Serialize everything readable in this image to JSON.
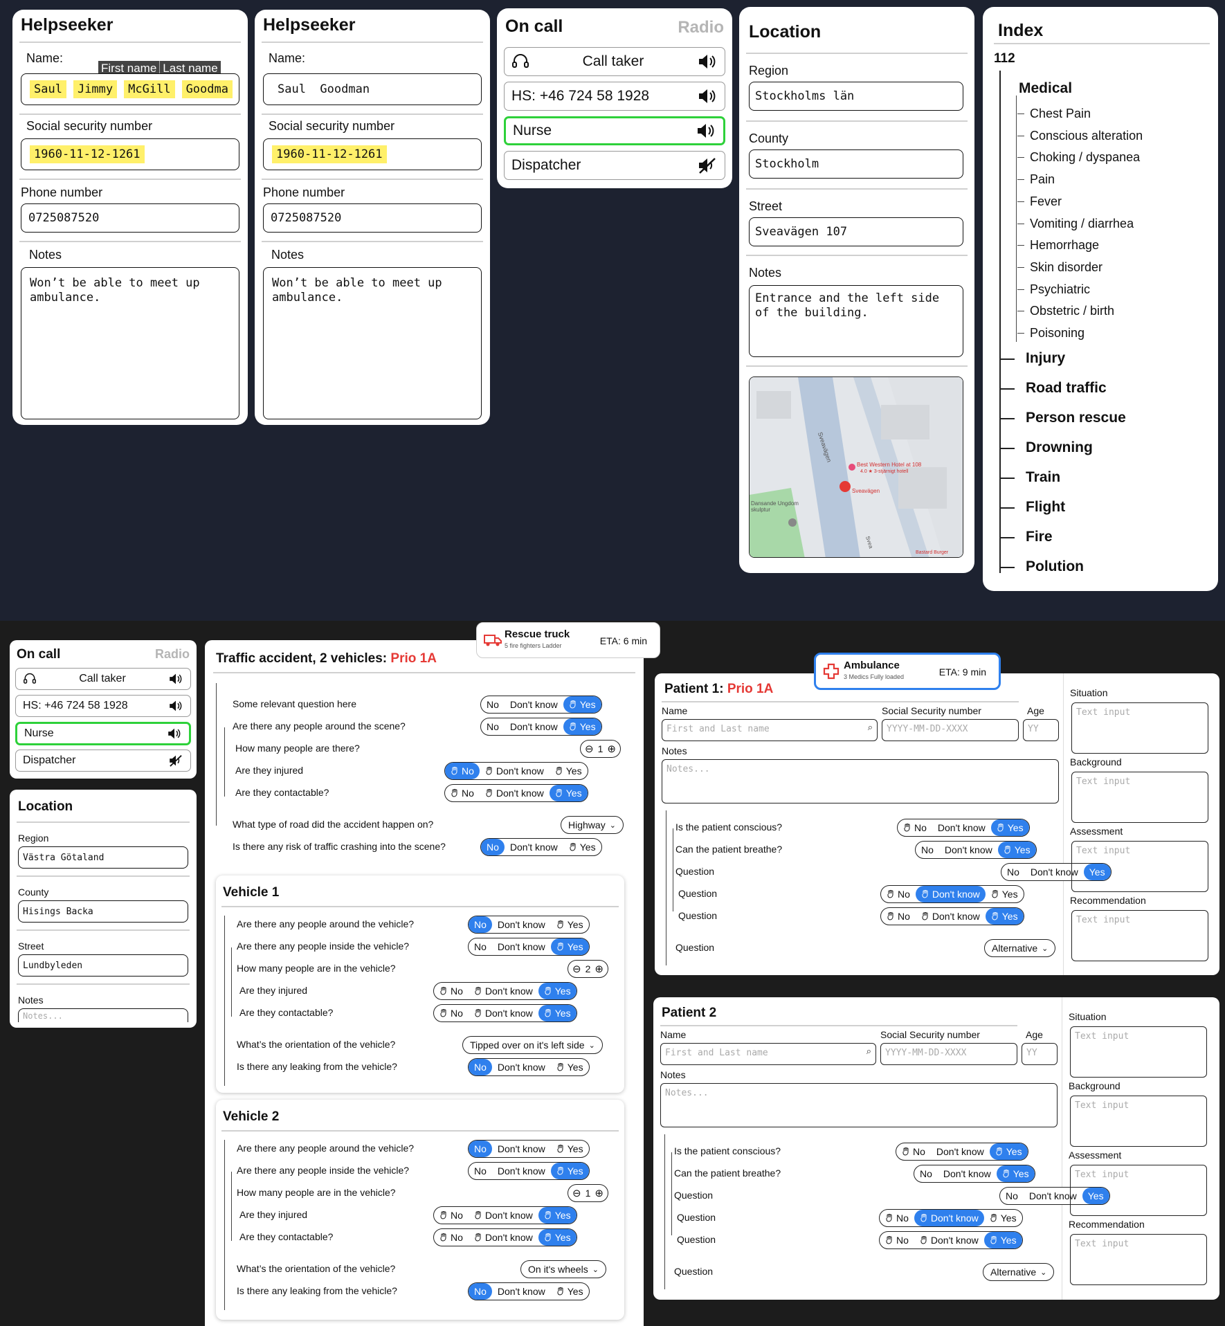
{
  "helpseeker1": {
    "title": "Helpseeker",
    "name_label": "Name:",
    "tooltip_first": "First name",
    "tooltip_last": "Last name",
    "name_parts": [
      "Saul",
      "Jimmy",
      "McGill",
      "Goodma"
    ],
    "ssn_label": "Social security number",
    "ssn": "1960-11-12-1261",
    "phone_label": "Phone number",
    "phone": "0725087520",
    "notes_label": "Notes",
    "notes": "Won’t be able to meet up ambulance."
  },
  "helpseeker2": {
    "title": "Helpseeker",
    "name_label": "Name:",
    "name": "Saul  Goodman",
    "ssn_label": "Social security number",
    "ssn": "1960-11-12-1261",
    "phone_label": "Phone number",
    "phone": "0725087520",
    "notes_label": "Notes",
    "notes": "Won’t be able to meet up ambulance."
  },
  "oncall": {
    "title": "On call",
    "radio": "Radio",
    "rows": [
      "Call taker",
      "HS: +46 724 58 1928",
      "Nurse",
      "Dispatcher"
    ]
  },
  "location1": {
    "title": "Location",
    "region_label": "Region",
    "region": "Stockholms län",
    "county_label": "County",
    "county": "Stockholm",
    "street_label": "Street",
    "street": "Sveavägen 107",
    "notes_label": "Notes",
    "notes": "Entrance and the left side of the building.",
    "map": {
      "street1": "Sveavägen",
      "street2": "Sveavägen",
      "hotel": "Best Western Hotel at 108",
      "hotel_sub": "4.0 ★ 3-stjärnigt hotell",
      "pin": "Sveavägen",
      "park": "Dansande Ungdom skulptur",
      "corner": "Bastard Burger",
      "street3": "Svea"
    }
  },
  "index": {
    "title": "Index",
    "root": "112",
    "medical": "Medical",
    "medical_items": [
      "Chest Pain",
      "Conscious alteration",
      "Choking / dyspanea",
      "Pain",
      "Fever",
      "Vomiting / diarrhea",
      "Hemorrhage",
      "Skin disorder",
      "Psychiatric",
      "Obstetric / birth",
      "Poisoning"
    ],
    "categories": [
      "Injury",
      "Road traffic",
      "Person rescue",
      "Drowning",
      "Train",
      "Flight",
      "Fire",
      "Polution"
    ]
  },
  "oncall2": {
    "title": "On call",
    "radio": "Radio",
    "rows": [
      "Call taker",
      "HS: +46 724 58 1928",
      "Nurse",
      "Dispatcher"
    ]
  },
  "location2": {
    "title": "Location",
    "region_label": "Region",
    "region": "Västra Götaland",
    "county_label": "County",
    "county": "Hisings Backa",
    "street_label": "Street",
    "street": "Lundbyleden",
    "notes_label": "Notes",
    "notes_placeholder": "Notes..."
  },
  "rescue": {
    "title": "Rescue truck",
    "sub": "5 fire fighters  Ladder",
    "eta": "ETA: 6 min"
  },
  "ambulance": {
    "title": "Ambulance",
    "sub": "3 Medics  Fully loaded",
    "eta": "ETA: 9 min"
  },
  "accident": {
    "title": "Traffic accident, 2 vehicles: ",
    "prio": "Prio 1A",
    "questions": [
      "Some relevant question here",
      "Are there any people around the scene?",
      "How many people are there?",
      "Are they injured",
      "Are they contactable?",
      "What type of road did the accident happen on?",
      "Is there any risk of traffic crashing into the scene?"
    ],
    "count": "1",
    "road": "Highway"
  },
  "vehicle1": {
    "title": "Vehicle 1",
    "questions": [
      "Are there any people around the vehicle?",
      "Are there any people inside the vehicle?",
      "How many people are in the vehicle?",
      "Are they injured",
      "Are they contactable?",
      "What’s the orientation of the vehicle?",
      "Is there any leaking from the vehicle?"
    ],
    "count": "2",
    "orientation": "Tipped over on it's left side"
  },
  "vehicle2": {
    "title": "Vehicle 2",
    "questions": [
      "Are there any people around the vehicle?",
      "Are there any people inside the vehicle?",
      "How many people are in the vehicle?",
      "Are they injured",
      "Are they contactable?",
      "What’s the orientation of the vehicle?",
      "Is there any leaking from the vehicle?"
    ],
    "count": "1",
    "orientation": "On it's wheels"
  },
  "toggle": {
    "no": "No",
    "dk": "Don't know",
    "yes": "Yes"
  },
  "patient1": {
    "title": "Patient 1: ",
    "prio": "Prio 1A",
    "name_label": "Name",
    "name_ph": "First and Last name",
    "ssn_label": "Social Security number",
    "ssn_ph": "YYYY-MM-DD-XXXX",
    "age_label": "Age",
    "age_ph": "YY",
    "notes_label": "Notes",
    "notes_ph": "Notes...",
    "questions": [
      "Is the patient conscious?",
      "Can the patient breathe?",
      "Question",
      "Question",
      "Question",
      "Question"
    ],
    "alt": "Alternative"
  },
  "patient2": {
    "title": "Patient 2",
    "name_label": "Name",
    "name_ph": "First and Last name",
    "ssn_label": "Social Security number",
    "ssn_ph": "YYYY-MM-DD-XXXX",
    "age_label": "Age",
    "age_ph": "YY",
    "notes_label": "Notes",
    "notes_ph": "Notes...",
    "questions": [
      "Is the patient conscious?",
      "Can the patient breathe?",
      "Question",
      "Question",
      "Question",
      "Question"
    ],
    "alt": "Alternative"
  },
  "sbar": {
    "labels": [
      "Situation",
      "Background",
      "Assessment",
      "Recommendation"
    ],
    "placeholder": "Text input"
  },
  "colors": {
    "accent": "#2f80ed",
    "prio": "#e53935",
    "active": "#2ed13a",
    "highlight": "#fff06a"
  }
}
